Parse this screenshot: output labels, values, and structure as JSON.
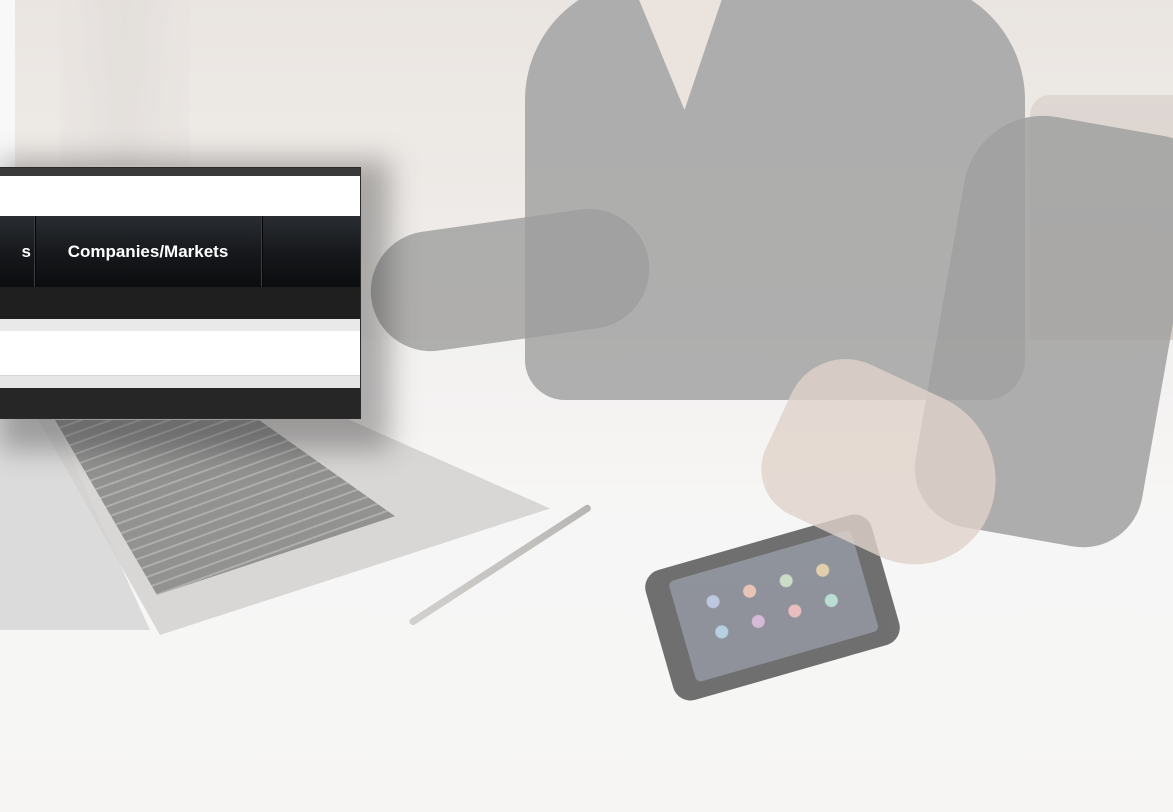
{
  "nav": {
    "items": [
      {
        "label": "s"
      },
      {
        "label": "Companies/Markets"
      }
    ]
  },
  "colors": {
    "nav_background": "#15171a",
    "nav_text": "#ffffff",
    "subbar": "#1f1f1f",
    "footer_bar": "#262626",
    "page_background": "#ffffff"
  }
}
